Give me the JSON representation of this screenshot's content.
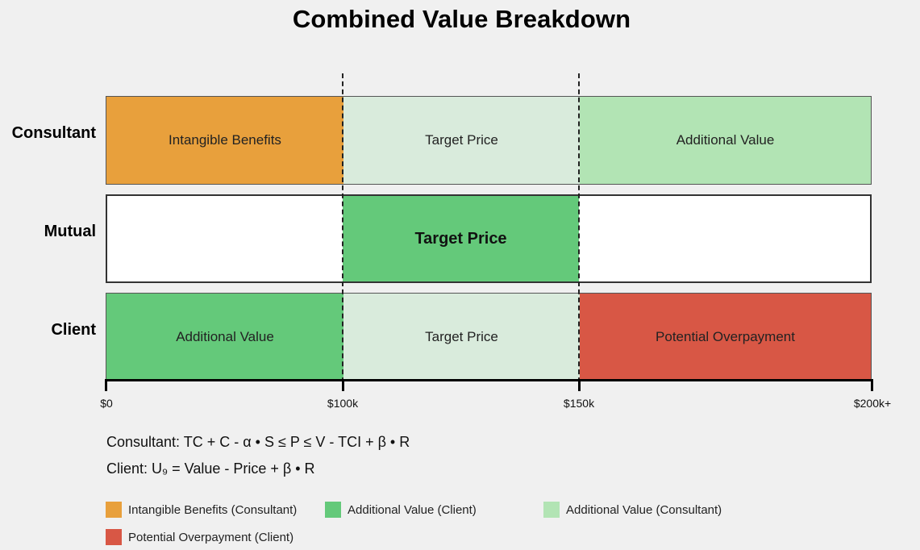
{
  "title": "Combined Value Breakdown",
  "colors": {
    "intangible": "#e8a03c",
    "target_light": "#d9ebdc",
    "additional_consultant": "#b2e4b4",
    "additional_client": "#64c97a",
    "target_mutual": "#64c97a",
    "overpayment": "#d85745",
    "mutual_empty": "#ffffff"
  },
  "rows": [
    {
      "label": "Consultant",
      "segments": [
        {
          "label": "Intangible Benefits",
          "from": "$0",
          "to": "$100k"
        },
        {
          "label": "Target Price",
          "from": "$100k",
          "to": "$150k"
        },
        {
          "label": "Additional Value",
          "from": "$150k",
          "to": "$200k+"
        }
      ]
    },
    {
      "label": "Mutual",
      "segments": [
        {
          "label": "",
          "from": "$0",
          "to": "$100k"
        },
        {
          "label": "Target Price",
          "from": "$100k",
          "to": "$150k"
        },
        {
          "label": "",
          "from": "$150k",
          "to": "$200k+"
        }
      ]
    },
    {
      "label": "Client",
      "segments": [
        {
          "label": "Additional Value",
          "from": "$0",
          "to": "$100k"
        },
        {
          "label": "Target Price",
          "from": "$100k",
          "to": "$150k"
        },
        {
          "label": "Potential Overpayment",
          "from": "$150k",
          "to": "$200k+"
        }
      ]
    }
  ],
  "axis": {
    "ticks": [
      "$0",
      "$100k",
      "$150k",
      "$200k+"
    ]
  },
  "formulas": {
    "consultant": "Consultant: TC + C - α • S ≤ P ≤ V - TCI + β • R",
    "client": "Client: U₉ = Value - Price + β • R"
  },
  "legend": [
    {
      "label": "Intangible Benefits (Consultant)",
      "color": "#e8a03c"
    },
    {
      "label": "Additional Value (Client)",
      "color": "#64c97a"
    },
    {
      "label": "Additional Value (Consultant)",
      "color": "#b2e4b4"
    },
    {
      "label": "Potential Overpayment (Client)",
      "color": "#d85745"
    }
  ]
}
